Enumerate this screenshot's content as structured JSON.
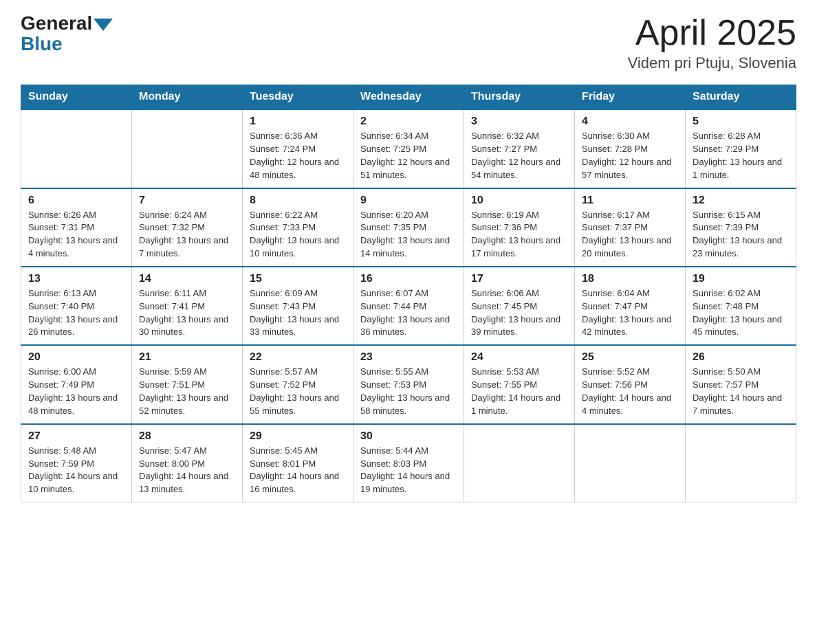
{
  "header": {
    "logo_general": "General",
    "logo_blue": "Blue",
    "month_year": "April 2025",
    "location": "Videm pri Ptuju, Slovenia"
  },
  "days_of_week": [
    "Sunday",
    "Monday",
    "Tuesday",
    "Wednesday",
    "Thursday",
    "Friday",
    "Saturday"
  ],
  "weeks": [
    [
      {
        "day": "",
        "info": ""
      },
      {
        "day": "",
        "info": ""
      },
      {
        "day": "1",
        "info": "Sunrise: 6:36 AM\nSunset: 7:24 PM\nDaylight: 12 hours\nand 48 minutes."
      },
      {
        "day": "2",
        "info": "Sunrise: 6:34 AM\nSunset: 7:25 PM\nDaylight: 12 hours\nand 51 minutes."
      },
      {
        "day": "3",
        "info": "Sunrise: 6:32 AM\nSunset: 7:27 PM\nDaylight: 12 hours\nand 54 minutes."
      },
      {
        "day": "4",
        "info": "Sunrise: 6:30 AM\nSunset: 7:28 PM\nDaylight: 12 hours\nand 57 minutes."
      },
      {
        "day": "5",
        "info": "Sunrise: 6:28 AM\nSunset: 7:29 PM\nDaylight: 13 hours\nand 1 minute."
      }
    ],
    [
      {
        "day": "6",
        "info": "Sunrise: 6:26 AM\nSunset: 7:31 PM\nDaylight: 13 hours\nand 4 minutes."
      },
      {
        "day": "7",
        "info": "Sunrise: 6:24 AM\nSunset: 7:32 PM\nDaylight: 13 hours\nand 7 minutes."
      },
      {
        "day": "8",
        "info": "Sunrise: 6:22 AM\nSunset: 7:33 PM\nDaylight: 13 hours\nand 10 minutes."
      },
      {
        "day": "9",
        "info": "Sunrise: 6:20 AM\nSunset: 7:35 PM\nDaylight: 13 hours\nand 14 minutes."
      },
      {
        "day": "10",
        "info": "Sunrise: 6:19 AM\nSunset: 7:36 PM\nDaylight: 13 hours\nand 17 minutes."
      },
      {
        "day": "11",
        "info": "Sunrise: 6:17 AM\nSunset: 7:37 PM\nDaylight: 13 hours\nand 20 minutes."
      },
      {
        "day": "12",
        "info": "Sunrise: 6:15 AM\nSunset: 7:39 PM\nDaylight: 13 hours\nand 23 minutes."
      }
    ],
    [
      {
        "day": "13",
        "info": "Sunrise: 6:13 AM\nSunset: 7:40 PM\nDaylight: 13 hours\nand 26 minutes."
      },
      {
        "day": "14",
        "info": "Sunrise: 6:11 AM\nSunset: 7:41 PM\nDaylight: 13 hours\nand 30 minutes."
      },
      {
        "day": "15",
        "info": "Sunrise: 6:09 AM\nSunset: 7:43 PM\nDaylight: 13 hours\nand 33 minutes."
      },
      {
        "day": "16",
        "info": "Sunrise: 6:07 AM\nSunset: 7:44 PM\nDaylight: 13 hours\nand 36 minutes."
      },
      {
        "day": "17",
        "info": "Sunrise: 6:06 AM\nSunset: 7:45 PM\nDaylight: 13 hours\nand 39 minutes."
      },
      {
        "day": "18",
        "info": "Sunrise: 6:04 AM\nSunset: 7:47 PM\nDaylight: 13 hours\nand 42 minutes."
      },
      {
        "day": "19",
        "info": "Sunrise: 6:02 AM\nSunset: 7:48 PM\nDaylight: 13 hours\nand 45 minutes."
      }
    ],
    [
      {
        "day": "20",
        "info": "Sunrise: 6:00 AM\nSunset: 7:49 PM\nDaylight: 13 hours\nand 48 minutes."
      },
      {
        "day": "21",
        "info": "Sunrise: 5:59 AM\nSunset: 7:51 PM\nDaylight: 13 hours\nand 52 minutes."
      },
      {
        "day": "22",
        "info": "Sunrise: 5:57 AM\nSunset: 7:52 PM\nDaylight: 13 hours\nand 55 minutes."
      },
      {
        "day": "23",
        "info": "Sunrise: 5:55 AM\nSunset: 7:53 PM\nDaylight: 13 hours\nand 58 minutes."
      },
      {
        "day": "24",
        "info": "Sunrise: 5:53 AM\nSunset: 7:55 PM\nDaylight: 14 hours\nand 1 minute."
      },
      {
        "day": "25",
        "info": "Sunrise: 5:52 AM\nSunset: 7:56 PM\nDaylight: 14 hours\nand 4 minutes."
      },
      {
        "day": "26",
        "info": "Sunrise: 5:50 AM\nSunset: 7:57 PM\nDaylight: 14 hours\nand 7 minutes."
      }
    ],
    [
      {
        "day": "27",
        "info": "Sunrise: 5:48 AM\nSunset: 7:59 PM\nDaylight: 14 hours\nand 10 minutes."
      },
      {
        "day": "28",
        "info": "Sunrise: 5:47 AM\nSunset: 8:00 PM\nDaylight: 14 hours\nand 13 minutes."
      },
      {
        "day": "29",
        "info": "Sunrise: 5:45 AM\nSunset: 8:01 PM\nDaylight: 14 hours\nand 16 minutes."
      },
      {
        "day": "30",
        "info": "Sunrise: 5:44 AM\nSunset: 8:03 PM\nDaylight: 14 hours\nand 19 minutes."
      },
      {
        "day": "",
        "info": ""
      },
      {
        "day": "",
        "info": ""
      },
      {
        "day": "",
        "info": ""
      }
    ]
  ]
}
